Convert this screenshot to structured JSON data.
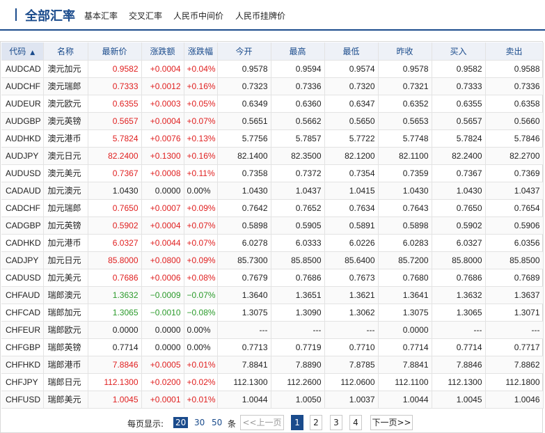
{
  "header": {
    "title": "全部汇率",
    "nav": [
      "基本汇率",
      "交叉汇率",
      "人民币中间价",
      "人民币挂牌价"
    ]
  },
  "table": {
    "columns": [
      "代码",
      "名称",
      "最新价",
      "涨跌额",
      "涨跌幅",
      "今开",
      "最高",
      "最低",
      "昨收",
      "买入",
      "卖出"
    ],
    "sorted_column": 0,
    "sort_direction": "asc",
    "rows": [
      [
        "AUDCAD",
        "澳元加元",
        "0.9582",
        "+0.0004",
        "+0.04%",
        "0.9578",
        "0.9594",
        "0.9574",
        "0.9578",
        "0.9582",
        "0.9588",
        "up"
      ],
      [
        "AUDCHF",
        "澳元瑞郎",
        "0.7333",
        "+0.0012",
        "+0.16%",
        "0.7323",
        "0.7336",
        "0.7320",
        "0.7321",
        "0.7333",
        "0.7336",
        "up"
      ],
      [
        "AUDEUR",
        "澳元欧元",
        "0.6355",
        "+0.0003",
        "+0.05%",
        "0.6349",
        "0.6360",
        "0.6347",
        "0.6352",
        "0.6355",
        "0.6358",
        "up"
      ],
      [
        "AUDGBP",
        "澳元英镑",
        "0.5657",
        "+0.0004",
        "+0.07%",
        "0.5651",
        "0.5662",
        "0.5650",
        "0.5653",
        "0.5657",
        "0.5660",
        "up"
      ],
      [
        "AUDHKD",
        "澳元港币",
        "5.7824",
        "+0.0076",
        "+0.13%",
        "5.7756",
        "5.7857",
        "5.7722",
        "5.7748",
        "5.7824",
        "5.7846",
        "up"
      ],
      [
        "AUDJPY",
        "澳元日元",
        "82.2400",
        "+0.1300",
        "+0.16%",
        "82.1400",
        "82.3500",
        "82.1200",
        "82.1100",
        "82.2400",
        "82.2700",
        "up"
      ],
      [
        "AUDUSD",
        "澳元美元",
        "0.7367",
        "+0.0008",
        "+0.11%",
        "0.7358",
        "0.7372",
        "0.7354",
        "0.7359",
        "0.7367",
        "0.7369",
        "up"
      ],
      [
        "CADAUD",
        "加元澳元",
        "1.0430",
        "0.0000",
        "0.00%",
        "1.0430",
        "1.0437",
        "1.0415",
        "1.0430",
        "1.0430",
        "1.0437",
        "flat"
      ],
      [
        "CADCHF",
        "加元瑞郎",
        "0.7650",
        "+0.0007",
        "+0.09%",
        "0.7642",
        "0.7652",
        "0.7634",
        "0.7643",
        "0.7650",
        "0.7654",
        "up"
      ],
      [
        "CADGBP",
        "加元英镑",
        "0.5902",
        "+0.0004",
        "+0.07%",
        "0.5898",
        "0.5905",
        "0.5891",
        "0.5898",
        "0.5902",
        "0.5906",
        "up"
      ],
      [
        "CADHKD",
        "加元港币",
        "6.0327",
        "+0.0044",
        "+0.07%",
        "6.0278",
        "6.0333",
        "6.0226",
        "6.0283",
        "6.0327",
        "6.0356",
        "up"
      ],
      [
        "CADJPY",
        "加元日元",
        "85.8000",
        "+0.0800",
        "+0.09%",
        "85.7300",
        "85.8500",
        "85.6400",
        "85.7200",
        "85.8000",
        "85.8500",
        "up"
      ],
      [
        "CADUSD",
        "加元美元",
        "0.7686",
        "+0.0006",
        "+0.08%",
        "0.7679",
        "0.7686",
        "0.7673",
        "0.7680",
        "0.7686",
        "0.7689",
        "up"
      ],
      [
        "CHFAUD",
        "瑞郎澳元",
        "1.3632",
        "−0.0009",
        "−0.07%",
        "1.3640",
        "1.3651",
        "1.3621",
        "1.3641",
        "1.3632",
        "1.3637",
        "down"
      ],
      [
        "CHFCAD",
        "瑞郎加元",
        "1.3065",
        "−0.0010",
        "−0.08%",
        "1.3075",
        "1.3090",
        "1.3062",
        "1.3075",
        "1.3065",
        "1.3071",
        "down"
      ],
      [
        "CHFEUR",
        "瑞郎欧元",
        "0.0000",
        "0.0000",
        "0.00%",
        "---",
        "---",
        "---",
        "0.0000",
        "---",
        "---",
        "flat"
      ],
      [
        "CHFGBP",
        "瑞郎英镑",
        "0.7714",
        "0.0000",
        "0.00%",
        "0.7713",
        "0.7719",
        "0.7710",
        "0.7714",
        "0.7714",
        "0.7717",
        "flat"
      ],
      [
        "CHFHKD",
        "瑞郎港币",
        "7.8846",
        "+0.0005",
        "+0.01%",
        "7.8841",
        "7.8890",
        "7.8785",
        "7.8841",
        "7.8846",
        "7.8862",
        "up"
      ],
      [
        "CHFJPY",
        "瑞郎日元",
        "112.1300",
        "+0.0200",
        "+0.02%",
        "112.1300",
        "112.2600",
        "112.0600",
        "112.1100",
        "112.1300",
        "112.1800",
        "up"
      ],
      [
        "CHFUSD",
        "瑞郎美元",
        "1.0045",
        "+0.0001",
        "+0.01%",
        "1.0044",
        "1.0050",
        "1.0037",
        "1.0044",
        "1.0045",
        "1.0046",
        "up"
      ]
    ]
  },
  "pager": {
    "per_page_label": "每页显示:",
    "sizes": [
      "20",
      "30",
      "50"
    ],
    "active_size": "20",
    "unit": "条",
    "prev": "<<上一页",
    "pages": [
      "1",
      "2",
      "3",
      "4"
    ],
    "active_page": "1",
    "next": "下一页>>"
  },
  "colors": {
    "brand": "#1a4b8c",
    "up": "#e02020",
    "down": "#2a9a2a"
  }
}
